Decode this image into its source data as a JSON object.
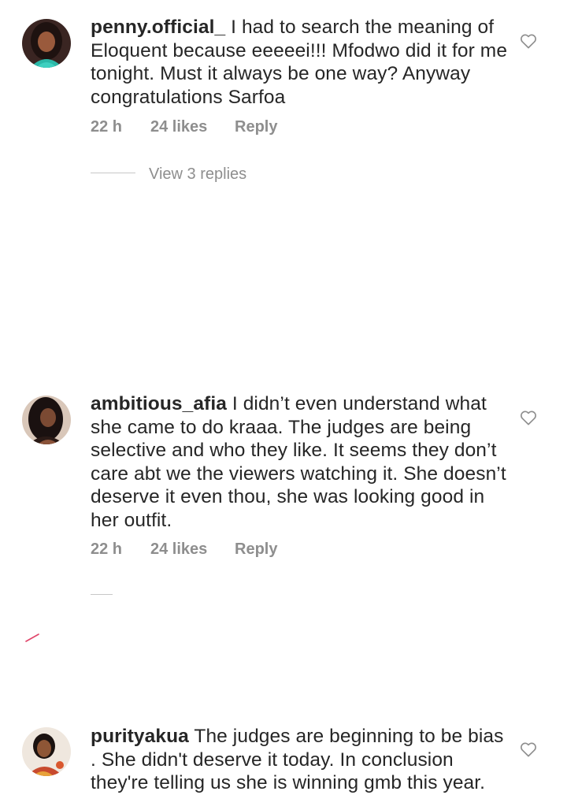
{
  "comments": [
    {
      "username": "penny.official_",
      "text": "I had to search the meaning of Eloquent because eeeeei!!! Mfodwo did it for me tonight. Must it always be one way? Anyway congratulations Sarfoa",
      "time": "22 h",
      "likes": "24 likes",
      "reply_label": "Reply",
      "view_replies": "View 3 replies",
      "avatar_icon": "profile-photo"
    },
    {
      "username": "ambitious_afia",
      "text": "I didn’t even understand what she came to do kraaa. The judges are being selective and who they like. It seems they don’t care abt we the viewers watching it. She doesn’t deserve it even thou, she was looking good in her outfit.",
      "time": "22 h",
      "likes": "24 likes",
      "reply_label": "Reply",
      "avatar_icon": "profile-photo"
    },
    {
      "username": "purityakua",
      "text": "The judges are beginning to be bias . She didn't deserve it today.  In conclusion they're telling us she is winning gmb this year.",
      "avatar_icon": "profile-photo"
    }
  ],
  "icons": {
    "like": "heart-outline-icon"
  },
  "colors": {
    "text": "#262626",
    "secondary": "#8e8e8e",
    "divider": "#c7c7c7"
  }
}
